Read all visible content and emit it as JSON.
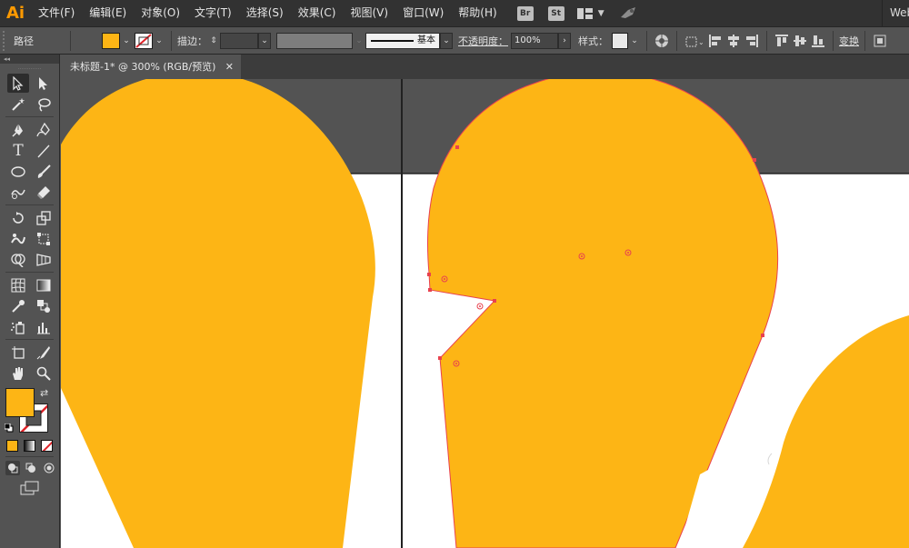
{
  "app": {
    "logo": "Ai"
  },
  "menubar": {
    "items": [
      "文件(F)",
      "编辑(E)",
      "对象(O)",
      "文字(T)",
      "选择(S)",
      "效果(C)",
      "视图(V)",
      "窗口(W)",
      "帮助(H)"
    ],
    "bridge_label": "Br",
    "stock_label": "St",
    "workspace_label": "Web"
  },
  "controlbar": {
    "selection_label": "路径",
    "stroke_label": "描边：",
    "brush_label": "基本",
    "opacity_label": "不透明度：",
    "opacity_value": "100%",
    "style_label": "样式：",
    "transform_label": "变换",
    "fill_color": "#FDB515",
    "stroke_color": "none"
  },
  "document": {
    "tab_title": "未标题-1* @ 300% (RGB/预览)",
    "close_glyph": "✕",
    "shape_fill": "#FDB515",
    "path_color": "#E8424F",
    "artboard_color": "#FFFFFF",
    "pasteboard_color": "#535353"
  },
  "tools": {
    "fill_color": "#FDB515",
    "stroke_color": "none",
    "icons": [
      "selection-icon",
      "direct-selection-icon",
      "magic-wand-icon",
      "lasso-icon",
      "pen-icon",
      "curvature-icon",
      "type-icon",
      "line-icon",
      "ellipse-icon",
      "paintbrush-icon",
      "shaper-icon",
      "eraser-icon",
      "rotate-icon",
      "scale-icon",
      "warp-icon",
      "free-transform-icon",
      "shape-builder-icon",
      "perspective-icon",
      "mesh-icon",
      "gradient-icon",
      "eyedropper-icon",
      "blend-icon",
      "symbol-sprayer-icon",
      "column-graph-icon",
      "artboard-icon",
      "slice-icon",
      "hand-icon",
      "zoom-icon"
    ]
  }
}
